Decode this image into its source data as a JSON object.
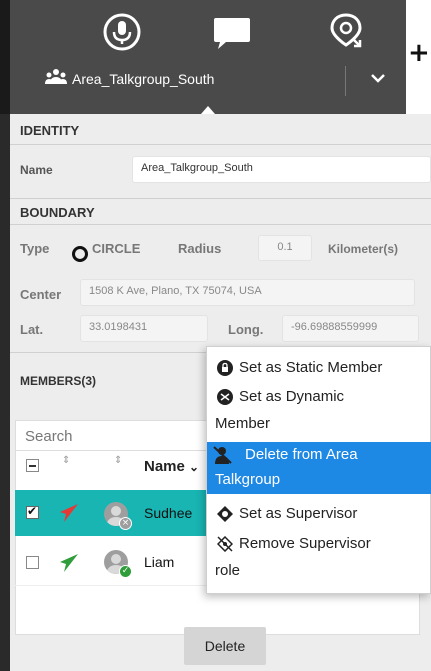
{
  "header": {
    "talkgroup_name": "Area_Talkgroup_South",
    "plus_label": "+",
    "icons": [
      "microphone-icon",
      "chat-bubble-icon",
      "location-pin-icon",
      "group-icon",
      "chevron-down-icon"
    ]
  },
  "identity": {
    "title": "IDENTITY",
    "name_label": "Name",
    "name_value": "Area_Talkgroup_South"
  },
  "boundary": {
    "title": "BOUNDARY",
    "type_label": "Type",
    "type_value": "CIRCLE",
    "radius_label": "Radius",
    "radius_value": "0.1",
    "radius_unit": "Kilometer(s)",
    "center_label": "Center",
    "center_value": "1508 K Ave, Plano, TX 75074, USA",
    "lat_label": "Lat.",
    "lat_value": "33.0198431",
    "long_label": "Long.",
    "long_value": "-96.69888559999"
  },
  "members": {
    "title": "MEMBERS(3)",
    "search_placeholder": "Search",
    "name_column": "Name",
    "name_column_sort": "⌄",
    "sort_glyph": "⇕",
    "rows": [
      {
        "name": "Sudhee",
        "selected": true,
        "arrow_color": "#e53935",
        "status_color": "#9e9e9e"
      },
      {
        "name": "Liam",
        "selected": false,
        "arrow_color": "#2e9d3a",
        "status_color": "#2e9d3a"
      }
    ],
    "delete_label": "Delete"
  },
  "context_menu": {
    "items": [
      {
        "line1": "Set as Static Member",
        "line2": "",
        "icon": "lock-icon",
        "highlighted": false
      },
      {
        "line1": "Set as Dynamic",
        "line2": "Member",
        "icon": "dynamic-member-icon",
        "highlighted": false
      },
      {
        "line1": "Delete from Area",
        "line2": "Talkgroup",
        "icon": "remove-user-icon",
        "highlighted": true
      },
      {
        "line1": "Set as Supervisor",
        "line2": "",
        "icon": "supervisor-icon",
        "highlighted": false
      },
      {
        "line1": "Remove Supervisor",
        "line2": "role",
        "icon": "remove-supervisor-icon",
        "highlighted": false
      }
    ]
  },
  "colors": {
    "header_bg": "#4a4a4a",
    "selected_row": "#18b5b3",
    "menu_highlight": "#1e88e5"
  }
}
